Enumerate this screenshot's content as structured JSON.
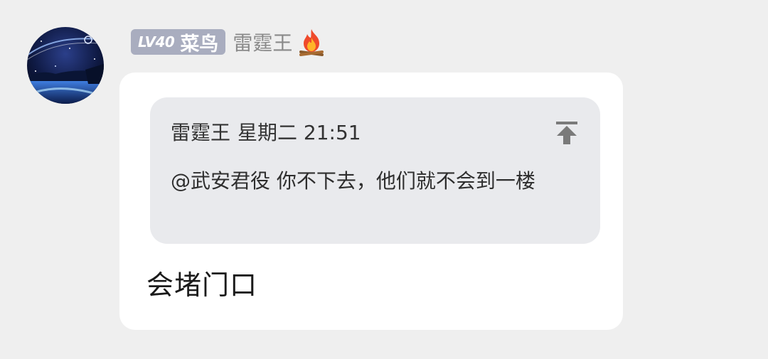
{
  "sender": {
    "level_label": "LV40",
    "level_title": "菜鸟",
    "name": "雷霆王",
    "fire_icon": "fire-icon",
    "badge_color": "#a9adbf"
  },
  "quote": {
    "author": "雷霆王",
    "time": "星期二 21:51",
    "text": "@武安君役 你不下去，他们就不会到一楼",
    "jump_icon": "jump-to-top-icon"
  },
  "message": {
    "text": "会堵门口"
  }
}
